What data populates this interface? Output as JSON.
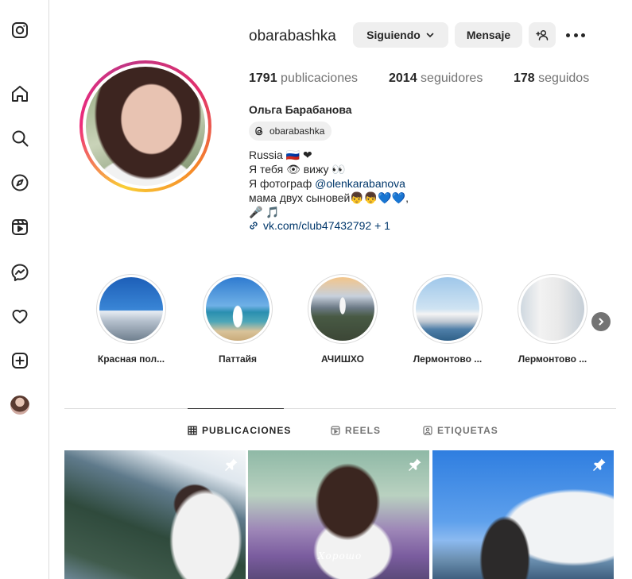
{
  "profile": {
    "username": "obarabashka",
    "full_name": "Ольга Барабанова",
    "follow_label": "Siguiendo",
    "message_label": "Mensaje",
    "threads_handle": "obarabashka",
    "stats": {
      "posts_count": "1791",
      "posts_label": "publicaciones",
      "followers_count": "2014",
      "followers_label": "seguidores",
      "following_count": "178",
      "following_label": "seguidos"
    },
    "bio": {
      "line1": "Russia 🇷🇺 ❤",
      "line2": "Я тебя 👁 вижу 👀",
      "line3_prefix": "Я фотограф ",
      "line3_mention": "@olenkarabanova",
      "line4": "мама двух сыновей👦👦💙💙,",
      "line5": "🎤 🎵"
    },
    "link": "vk.com/club47432792 + 1"
  },
  "highlights": [
    {
      "label": "Красная пол..."
    },
    {
      "label": "Паттайя"
    },
    {
      "label": "АЧИШХО"
    },
    {
      "label": "Лермонтово ..."
    },
    {
      "label": "Лермонтово ..."
    }
  ],
  "tabs": [
    {
      "label": "PUBLICACIONES",
      "active": true
    },
    {
      "label": "REELS",
      "active": false
    },
    {
      "label": "ETIQUETAS",
      "active": false
    }
  ],
  "posts": [
    {
      "caption": "",
      "pinned": true
    },
    {
      "caption": "Хорошо",
      "pinned": true
    },
    {
      "caption": "",
      "pinned": true
    }
  ],
  "icons": {
    "nav": [
      "instagram-logo-icon",
      "home-icon",
      "search-icon",
      "explore-icon",
      "reels-icon",
      "messenger-icon",
      "notifications-heart-icon",
      "create-plus-icon",
      "profile-avatar"
    ],
    "colors": {
      "link": "#00376b",
      "muted": "#737373",
      "text": "#262626",
      "button_bg": "#efefef"
    }
  }
}
